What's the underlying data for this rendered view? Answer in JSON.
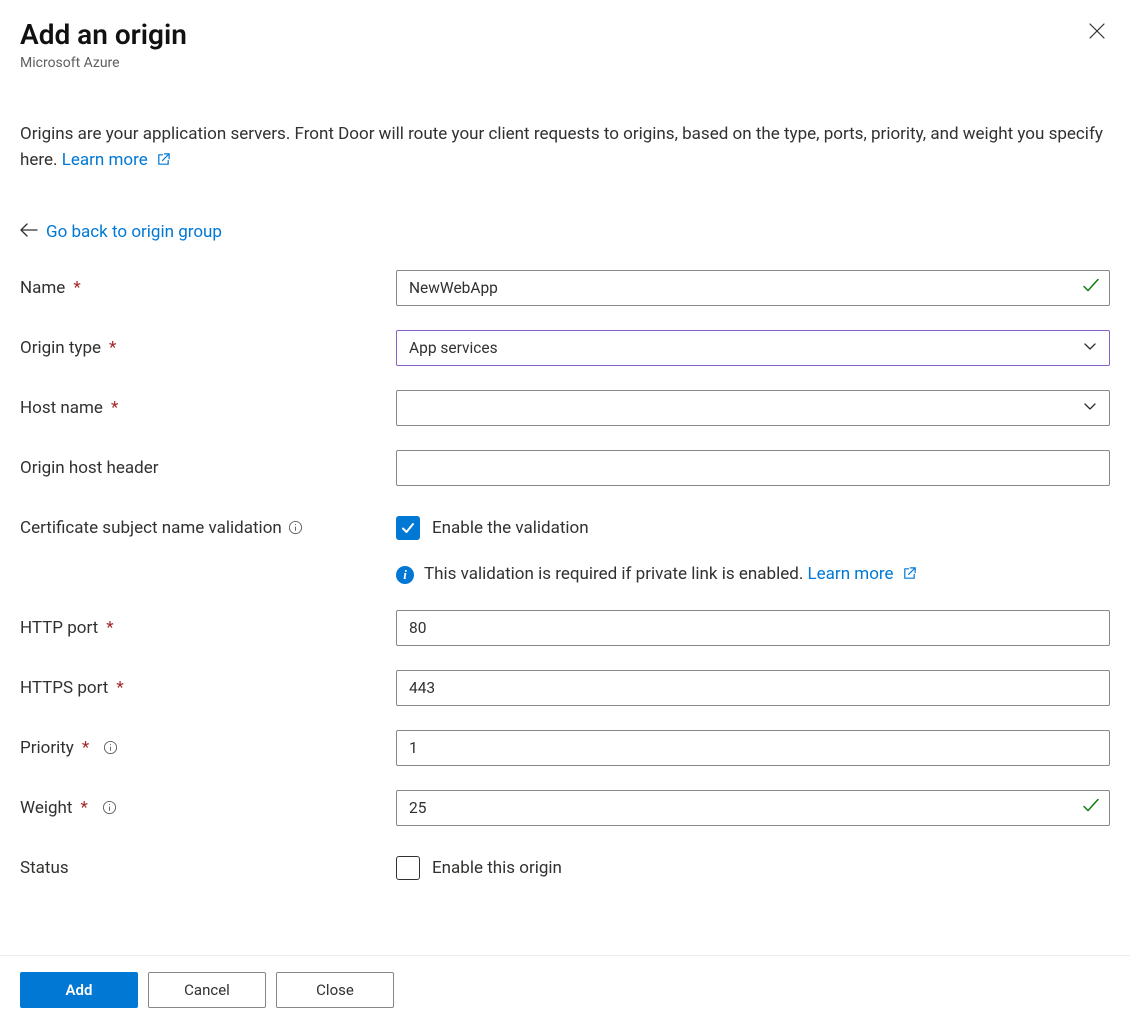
{
  "header": {
    "title": "Add an origin",
    "subtitle": "Microsoft Azure"
  },
  "description": {
    "text": "Origins are your application servers. Front Door will route your client requests to origins, based on the type, ports, priority, and weight you specify here. ",
    "learn_more": "Learn more"
  },
  "back_link": "Go back to origin group",
  "fields": {
    "name": {
      "label": "Name",
      "value": "NewWebApp"
    },
    "origin_type": {
      "label": "Origin type",
      "value": "App services"
    },
    "host_name": {
      "label": "Host name",
      "value": ""
    },
    "origin_host_header": {
      "label": "Origin host header",
      "value": ""
    },
    "cert_validation": {
      "label": "Certificate subject name validation",
      "checkbox_label": "Enable the validation"
    },
    "validation_info": {
      "text": "This validation is required if private link is enabled. ",
      "learn_more": "Learn more"
    },
    "http_port": {
      "label": "HTTP port",
      "value": "80"
    },
    "https_port": {
      "label": "HTTPS port",
      "value": "443"
    },
    "priority": {
      "label": "Priority",
      "value": "1"
    },
    "weight": {
      "label": "Weight",
      "value": "25"
    },
    "status": {
      "label": "Status",
      "checkbox_label": "Enable this origin"
    }
  },
  "footer": {
    "add": "Add",
    "cancel": "Cancel",
    "close": "Close"
  }
}
